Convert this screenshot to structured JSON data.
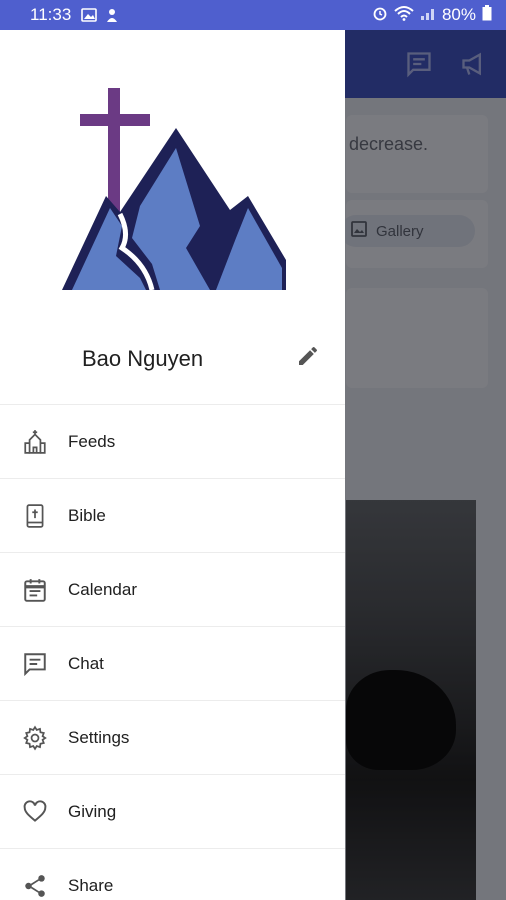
{
  "status_bar": {
    "time": "11:33",
    "battery": "80%",
    "icons": [
      "image-icon",
      "notification-icon",
      "alarm-icon",
      "wifi-icon",
      "signal-icon",
      "battery-icon"
    ]
  },
  "background": {
    "text_snippet": "decrease.",
    "gallery_label": "Gallery",
    "appbar_icons": [
      "chat-icon",
      "megaphone-icon"
    ],
    "colors": {
      "appbar": "#3c4cae",
      "statusbar": "#4f5fce"
    }
  },
  "drawer": {
    "logo": "cross-mountain-logo",
    "profile": {
      "name": "Bao Nguyen"
    },
    "menu": [
      {
        "label": "Feeds",
        "icon": "church-icon"
      },
      {
        "label": "Bible",
        "icon": "bible-icon"
      },
      {
        "label": "Calendar",
        "icon": "calendar-icon"
      },
      {
        "label": "Chat",
        "icon": "chat-icon"
      },
      {
        "label": "Settings",
        "icon": "gear-icon"
      },
      {
        "label": "Giving",
        "icon": "heart-icon"
      },
      {
        "label": "Share",
        "icon": "share-icon"
      }
    ],
    "colors": {
      "cross": "#6b3a84",
      "mountain_dark": "#1e2156",
      "mountain_light": "#5d7dc4",
      "icon": "#555555"
    }
  }
}
